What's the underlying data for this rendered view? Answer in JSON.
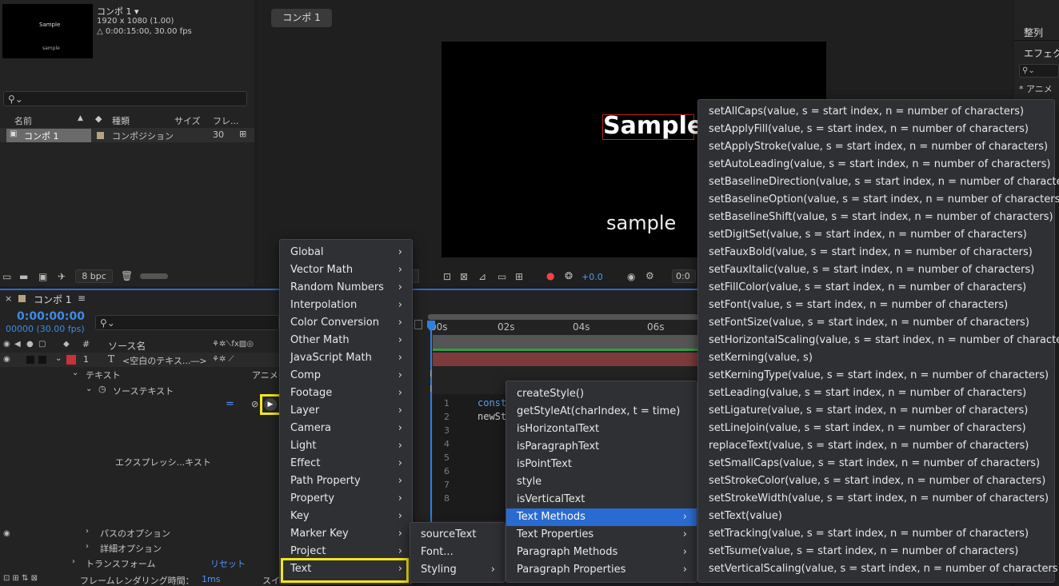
{
  "project": {
    "comp_name": "コンポ 1 ▾",
    "comp_size": "1920 x 1080 (1.00)",
    "comp_duration": "△ 0:00:15:00, 30.00 fps",
    "thumb_text_top": "Sample",
    "thumb_text_bottom": "sample",
    "search_icon": "search-icon",
    "columns": {
      "name": "名前",
      "type": "種類",
      "size": "サイズ",
      "frame": "フレ..."
    },
    "row": {
      "name": "コンポ 1",
      "type": "コンポジション",
      "frames": "30"
    },
    "bpc": "8 bpc"
  },
  "viewer": {
    "tab": "コンポ 1",
    "sample_big": "Sample",
    "sample_small": "sample",
    "exposure": "+0.0",
    "timecode": "0:0"
  },
  "right_panel": {
    "align": "整列",
    "effects": "エフェク",
    "anim": "* アニメ"
  },
  "timeline": {
    "tab": "コンポ 1",
    "timecode": "0:00:00:00",
    "frame_info": "00000 (30.00 fps)",
    "col_source": "ソース名",
    "layer_num": "1",
    "layer_name": "<空白のテキス...―>",
    "prop_text": "テキスト",
    "prop_anim": "アニメー",
    "prop_source_text": "ソーステキスト",
    "expr_label": "エクスプレッシ...キスト",
    "path_options": "パスのオプション",
    "more_options": "詳細オプション",
    "transform": "トランスフォーム",
    "reset": "リセット",
    "render_time_label": "フレームレンダリング時間：",
    "render_time_value": "1ms",
    "switch_label": "スイ",
    "ruler": [
      "00s",
      "02s",
      "04s",
      "06s"
    ],
    "line_numbers": [
      "1",
      "2",
      "3",
      "4",
      "5",
      "6",
      "7",
      "8"
    ],
    "code_line1": "const",
    "code_line2": "newSt"
  },
  "menu_main": [
    "Global",
    "Vector Math",
    "Random Numbers",
    "Interpolation",
    "Color Conversion",
    "Other Math",
    "JavaScript Math",
    "Comp",
    "Footage",
    "Layer",
    "Camera",
    "Light",
    "Effect",
    "Path Property",
    "Property",
    "Key",
    "Marker Key",
    "Project",
    "Text"
  ],
  "menu_text": [
    "sourceText",
    "Font...",
    "Styling"
  ],
  "menu_styling": [
    "createStyle()",
    "getStyleAt(charIndex, t = time)",
    "isHorizontalText",
    "isParagraphText",
    "isPointText",
    "style",
    "isVerticalText",
    "Text Methods",
    "Text Properties",
    "Paragraph Methods",
    "Paragraph Properties"
  ],
  "menu_methods": [
    "setAllCaps(value, s = start index, n = number of characters)",
    "setApplyFill(value, s = start index, n = number of characters)",
    "setApplyStroke(value, s = start index, n = number of characters)",
    "setAutoLeading(value, s = start index, n = number of characters)",
    "setBaselineDirection(value, s = start index, n = number of characters)",
    "setBaselineOption(value, s = start index, n = number of characters)",
    "setBaselineShift(value, s = start index, n = number of characters)",
    "setDigitSet(value, s = start index, n = number of characters)",
    "setFauxBold(value, s = start index, n = number of characters)",
    "setFauxItalic(value, s = start index, n = number of characters)",
    "setFillColor(value, s = start index, n = number of characters)",
    "setFont(value, s = start index, n = number of characters)",
    "setFontSize(value, s = start index, n = number of characters)",
    "setHorizontalScaling(value, s = start index, n = number of characters)",
    "setKerning(value, s)",
    "setKerningType(value, s = start index, n = number of characters)",
    "setLeading(value, s = start index, n = number of characters)",
    "setLigature(value, s = start index, n = number of characters)",
    "setLineJoin(value, s = start index, n = number of characters)",
    "replaceText(value, s = start index, n = number of characters)",
    "setSmallCaps(value, s = start index, n = number of characters)",
    "setStrokeColor(value, s = start index, n = number of characters)",
    "setStrokeWidth(value, s = start index, n = number of characters)",
    "setText(value)",
    "setTracking(value, s = start index, n = number of characters)",
    "setTsume(value, s = start index, n = number of characters)",
    "setVerticalScaling(value, s = start index, n = number of characters)"
  ],
  "colors": {
    "accent": "#2a6bd1",
    "highlight": "#f3e61d",
    "timecode": "#3d8be8",
    "layer_label": "#c8323a",
    "playhead": "#2f7fe0"
  }
}
